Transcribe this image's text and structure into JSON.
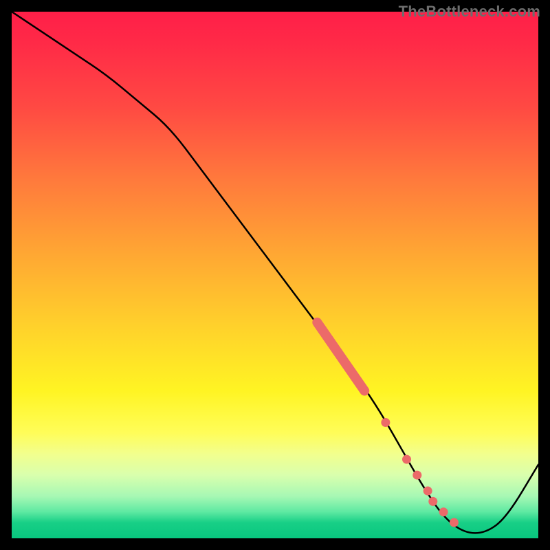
{
  "watermark": "TheBottleneck.com",
  "colors": {
    "frame": "#000000",
    "watermark": "#6d6d6d",
    "curve": "#000000",
    "marker": "#ec6a69",
    "gradient_top": "#ff1f48",
    "gradient_bottom": "#08c77f"
  },
  "chart_data": {
    "type": "line",
    "title": "",
    "xlabel": "",
    "ylabel": "",
    "xlim": [
      0,
      100
    ],
    "ylim": [
      0,
      100
    ],
    "grid": false,
    "legend": false,
    "series": [
      {
        "name": "bottleneck-curve",
        "x": [
          0,
          6,
          12,
          18,
          24,
          30,
          36,
          42,
          48,
          54,
          60,
          66,
          70,
          74,
          78,
          82,
          86,
          90,
          94,
          100
        ],
        "y": [
          100,
          96,
          92,
          88,
          83,
          78,
          70,
          62,
          54,
          46,
          38,
          30,
          24,
          17,
          10,
          4,
          1,
          1,
          4,
          14
        ]
      }
    ],
    "highlighted_segment": {
      "name": "thick-marker-band",
      "x_start": 58,
      "x_end": 67,
      "y_start": 41,
      "y_end": 28
    },
    "extra_markers": [
      {
        "x": 71,
        "y": 22
      },
      {
        "x": 75,
        "y": 15
      },
      {
        "x": 77,
        "y": 12
      },
      {
        "x": 79,
        "y": 9
      },
      {
        "x": 80,
        "y": 7
      },
      {
        "x": 82,
        "y": 5
      },
      {
        "x": 84,
        "y": 3
      }
    ],
    "gradient_background": {
      "direction": "vertical",
      "meaning": "red-high-to-green-low",
      "stops": [
        {
          "pos": 0.0,
          "color": "#ff1f48"
        },
        {
          "pos": 0.18,
          "color": "#ff4943"
        },
        {
          "pos": 0.46,
          "color": "#ffa733"
        },
        {
          "pos": 0.72,
          "color": "#fff423"
        },
        {
          "pos": 0.88,
          "color": "#d9ffad"
        },
        {
          "pos": 1.0,
          "color": "#08c77f"
        }
      ]
    }
  }
}
